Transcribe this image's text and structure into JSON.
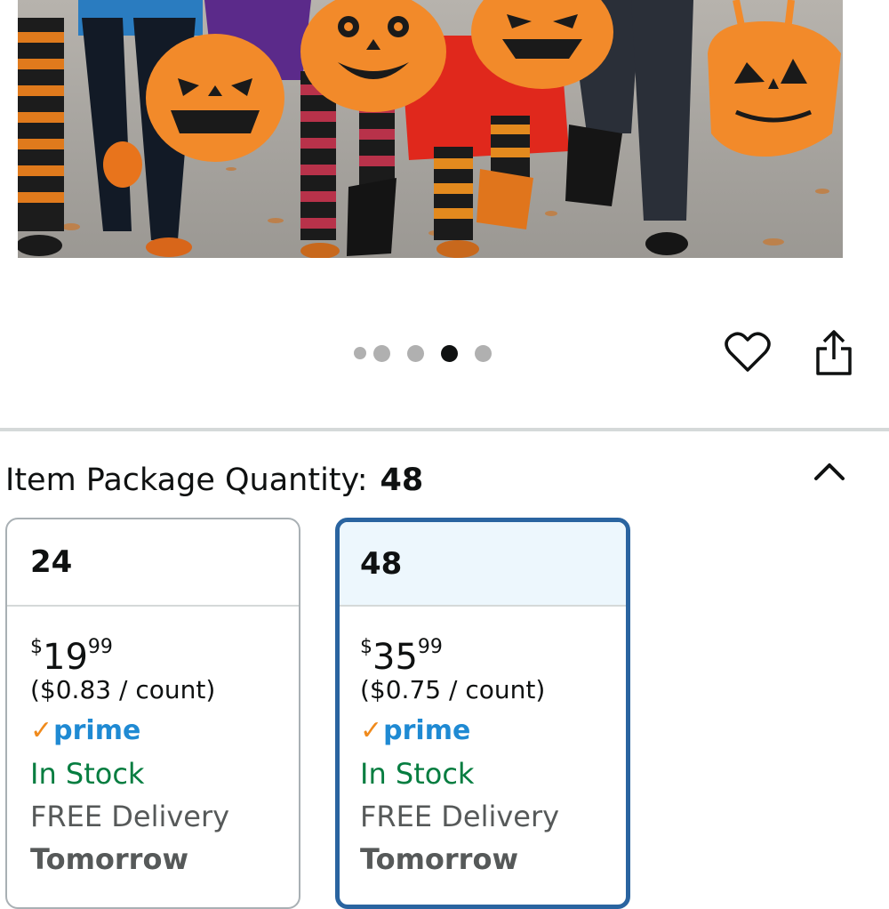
{
  "icons": {
    "favorite": "heart-icon",
    "share": "share-icon",
    "collapse": "chevron-up-icon",
    "prime_check": "checkmark-icon"
  },
  "colors": {
    "selected_border": "#2a64a0",
    "selected_header_bg": "#edf7fd",
    "in_stock": "#067d40",
    "prime_blue": "#1f8ad3",
    "prime_check": "#f08a1c",
    "pumpkin_orange": "#f28a2a"
  },
  "carousel": {
    "total_dots": 5,
    "active_index": 4
  },
  "quantity": {
    "label": "Item Package Quantity:",
    "selected_value": "48"
  },
  "options": [
    {
      "count": "24",
      "currency": "$",
      "price_whole": "19",
      "price_fraction": "99",
      "unit_price": "($0.83 / count)",
      "prime_check": "✓",
      "prime_label": "prime",
      "stock": "In Stock",
      "delivery": "FREE Delivery",
      "delivery_when": "Tomorrow",
      "selected": false
    },
    {
      "count": "48",
      "currency": "$",
      "price_whole": "35",
      "price_fraction": "99",
      "unit_price": "($0.75 / count)",
      "prime_check": "✓",
      "prime_label": "prime",
      "stock": "In Stock",
      "delivery": "FREE Delivery",
      "delivery_when": "Tomorrow",
      "selected": true
    }
  ]
}
